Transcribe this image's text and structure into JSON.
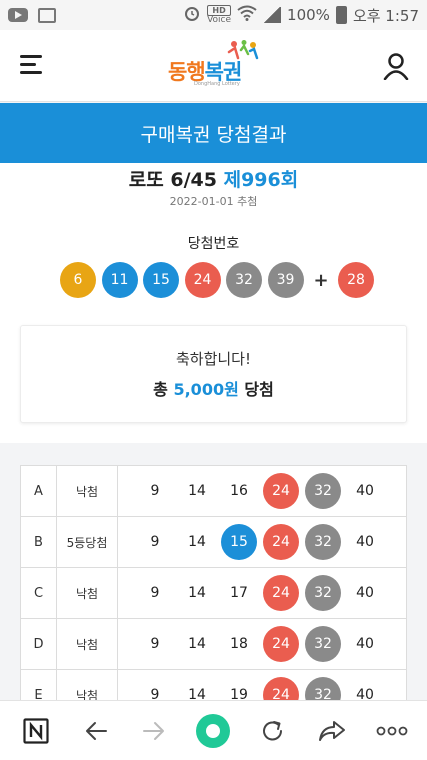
{
  "status": {
    "hd": "HD",
    "voice": "Voice",
    "battery": "100%",
    "time": "오후 1:57"
  },
  "header": {
    "logo_text_1": "동행",
    "logo_text_2": "복권",
    "logo_sub": "DongHang Lottery"
  },
  "band": {
    "title": "구매복권 당첨결과"
  },
  "draw": {
    "game": "로또 6/45",
    "round": "제996회",
    "date": "2022-01-01 추첨",
    "win_label": "당첨번호",
    "numbers": [
      6,
      11,
      15,
      24,
      32,
      39
    ],
    "plus": "+",
    "bonus": 28
  },
  "congrats": {
    "line1": "축하합니다!",
    "prefix": "총",
    "amount": "5,000원",
    "suffix": "당첨"
  },
  "tickets": [
    {
      "line": "A",
      "result": "낙첨",
      "numbers": [
        9,
        14,
        16,
        24,
        32,
        40
      ]
    },
    {
      "line": "B",
      "result": "5등당첨",
      "numbers": [
        9,
        14,
        15,
        24,
        32,
        40
      ]
    },
    {
      "line": "C",
      "result": "낙첨",
      "numbers": [
        9,
        14,
        17,
        24,
        32,
        40
      ]
    },
    {
      "line": "D",
      "result": "낙첨",
      "numbers": [
        9,
        14,
        18,
        24,
        32,
        40
      ]
    },
    {
      "line": "E",
      "result": "낙첨",
      "numbers": [
        9,
        14,
        19,
        24,
        32,
        40
      ]
    }
  ],
  "ball_colors": {
    "1-10": "#e8a514",
    "11-20": "#1c8fd8",
    "21-30": "#ea5d4f",
    "31-40": "#8a8a8a",
    "41-45": "#6bbf45"
  },
  "colors": {
    "brand_blue": "#1a8fd8",
    "accent_green": "#20c997"
  },
  "bottom_nav": [
    "naver-icon",
    "back-icon",
    "forward-icon",
    "home-icon",
    "refresh-icon",
    "share-icon",
    "more-icon"
  ]
}
